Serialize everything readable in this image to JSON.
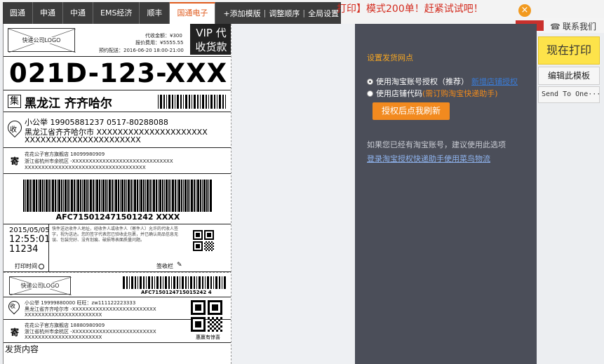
{
  "tabs": [
    {
      "label": "圆通"
    },
    {
      "label": "申通"
    },
    {
      "label": "中通"
    },
    {
      "label": "EMS经济"
    },
    {
      "label": "顺丰"
    },
    {
      "label": "国通电子"
    }
  ],
  "tools": {
    "add_template": "+添加模版",
    "reorder": "调整顺序",
    "global_settings": "全局设置"
  },
  "promo_text": "打印】模式200单！赶紧试试吧！",
  "close_icon": "×",
  "contact": {
    "label": "联系我们",
    "icon": "headset-icon"
  },
  "buttons": {
    "print": "现在打印",
    "edit_template": "编辑此模板",
    "send_to": "Send To One···"
  },
  "waybill": {
    "logo_text": "快递公司LOGO",
    "cod_amount": "代收金额：¥300",
    "insured_fee": "报价费用：¥5555.55",
    "scheduled": "预约配送：2016-06-20 18:00-21:00",
    "vip_line1": "VIP 代",
    "vip_line2": "收货款",
    "route_code": "021D-123-XXX",
    "collect_badge": "集",
    "collect_city": "黑龙江  齐齐哈尔",
    "recv_badge": "收",
    "recv_name_phone": "小公举   19905881237    0517-80288088",
    "recv_addr1": "黑龙江省齐齐哈尔市 XXXXXXXXXXXXXXXXXXXXX",
    "recv_addr2": "XXXXXXXXXXXXXXXXXXXXXX",
    "send_badge": "寄",
    "send_name_phone": "花花公子官方旗舰店   18099980909",
    "send_addr1": "浙江省杭州市余杭区 -XXXXXXXXXXXXXXXXXXXXXXXXXXXXXX",
    "send_addr2": "XXXXXXXXXXXXXXXXXXXXXXXXXXXXXXXXXXXX",
    "barcode_number": "AFC715012471501242 XXXX",
    "print_date": "2015/05/05",
    "print_time": "12:55:01",
    "print_seq": "11234",
    "terms_text": "快件送达收件人地址，经收件人或收件人（寄件人）允许的代收人签字，视为送达。您的签字代表您已验收此包裹，并已确认商品信息无误、包装完好、没有划痕、破损等表面质量问题。",
    "print_time_label": "打印时间",
    "sign_label": "签收栏",
    "lower_barcode_number": "AFC7150124715015242 4",
    "lower_logo_text": "快递公司LOGO",
    "lower_recv_line": "小公举    19999880000     旺旺：zw111122223333",
    "lower_recv_addr1": "黑龙江省齐齐哈尔市 -XXXXXXXXXXXXXXXXXXXXXXXXX",
    "lower_recv_addr2": "XXXXXXXXXXXXXXXXXXXXXXX",
    "lower_send_line": "花花公子官方旗舰店     18880980909",
    "lower_send_addr1": "浙江省杭州市余杭区 -XXXXXXXXXXXXXXXXXXXXXXXXX",
    "lower_send_addr2": "XXXXXXXXXXXXXXXXXXXXXXX",
    "surprise": "惠赢有惊喜",
    "content_label": "发货内容"
  },
  "dialog": {
    "title": "设置发货网点",
    "option1": "使用淘宝账号授权（推荐）",
    "option1_link": "新增店铺授权",
    "option2": "使用店铺代码",
    "option2_note": "(需订购淘宝快递助手)",
    "refresh_button": "授权后点我刷新",
    "hint": "如果您已经有淘宝账号，建议使用此选项",
    "login_link": "登录淘宝授权快递助手使用菜鸟物流"
  },
  "colors": {
    "accent_orange": "#f28a1f",
    "promo_red": "#d32b1e",
    "print_yellow": "#fde34a",
    "dialog_bg": "#4b4e59"
  }
}
